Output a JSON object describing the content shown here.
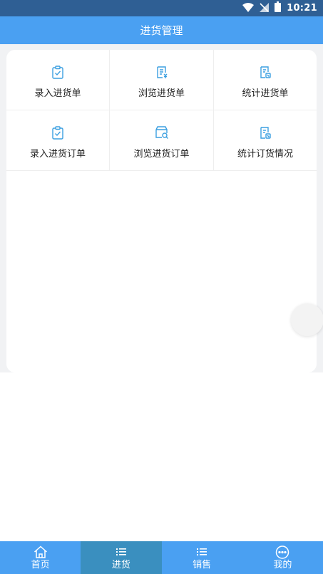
{
  "status_bar": {
    "time": "10:21",
    "icons": [
      "wifi-icon",
      "no-signal-icon",
      "battery-icon"
    ]
  },
  "header": {
    "title": "进货管理"
  },
  "menu": {
    "items": [
      {
        "label": "录入进货单",
        "icon": "clipboard-check-icon"
      },
      {
        "label": "浏览进货单",
        "icon": "document-list-icon"
      },
      {
        "label": "统计进货单",
        "icon": "document-stats-icon"
      },
      {
        "label": "录入进货订单",
        "icon": "clipboard-check-icon"
      },
      {
        "label": "浏览进货订单",
        "icon": "box-search-icon"
      },
      {
        "label": "统计订货情况",
        "icon": "document-stats-icon"
      }
    ]
  },
  "tab_bar": {
    "tabs": [
      {
        "label": "首页",
        "icon": "home-icon",
        "active": false
      },
      {
        "label": "进货",
        "icon": "list-icon",
        "active": true
      },
      {
        "label": "销售",
        "icon": "list-icon",
        "active": false
      },
      {
        "label": "我的",
        "icon": "chat-bubble-icon",
        "active": false
      }
    ]
  },
  "colors": {
    "status_bar": "#2f5f94",
    "title_bar": "#4aa0f2",
    "tab_active": "#3a8fbf",
    "icon_accent": "#3b9fe0"
  }
}
